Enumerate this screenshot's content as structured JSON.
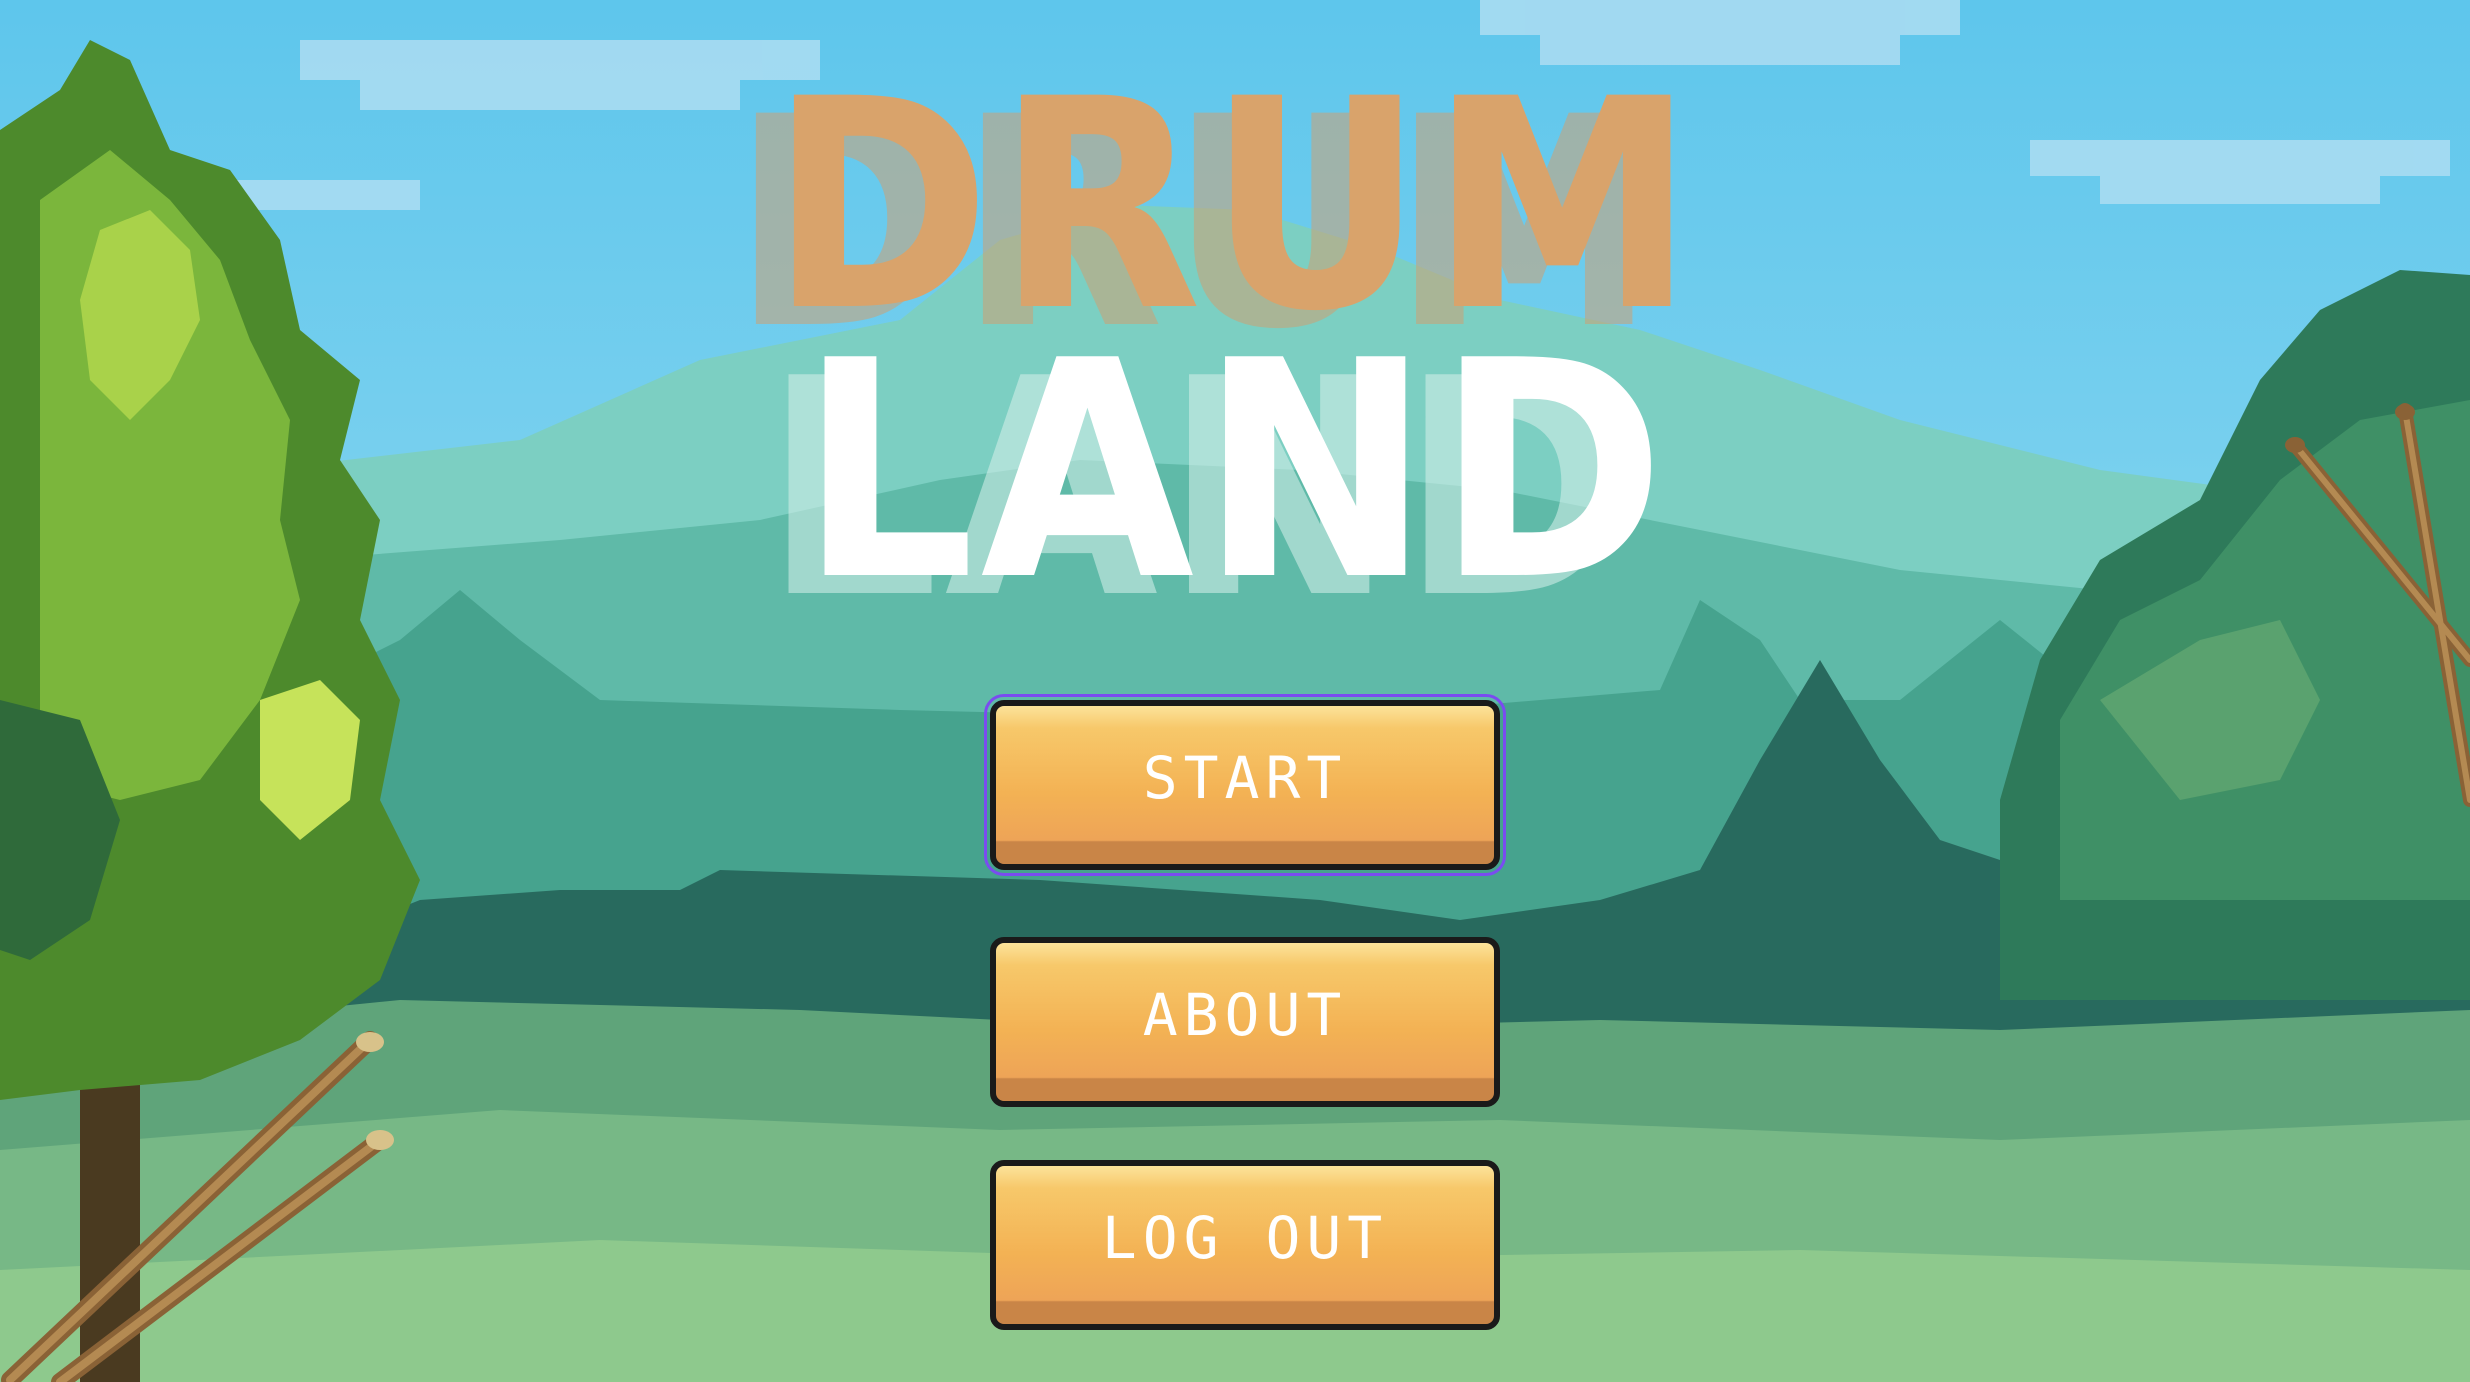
{
  "title": {
    "line1": "DRUM",
    "line2": "LAND"
  },
  "menu": {
    "start_label": "START",
    "about_label": "ABOUT",
    "logout_label": "LOG OUT",
    "selected": "START"
  },
  "colors": {
    "title_drum": "#d9a36b",
    "title_land": "#ffffff",
    "button_face": "#f3b254",
    "button_highlight": "#fce39a",
    "button_shadow": "#c98547",
    "button_border": "#1a1a1a",
    "selection_outline": "#7a4cf0",
    "sky": "#72c9ea",
    "mountain": "#6fc2b4",
    "forest_dark": "#2b6b5e",
    "meadow": "#86c489"
  },
  "icons": {
    "decor_left": "drumsticks-icon",
    "decor_right": "drumsticks-icon"
  }
}
